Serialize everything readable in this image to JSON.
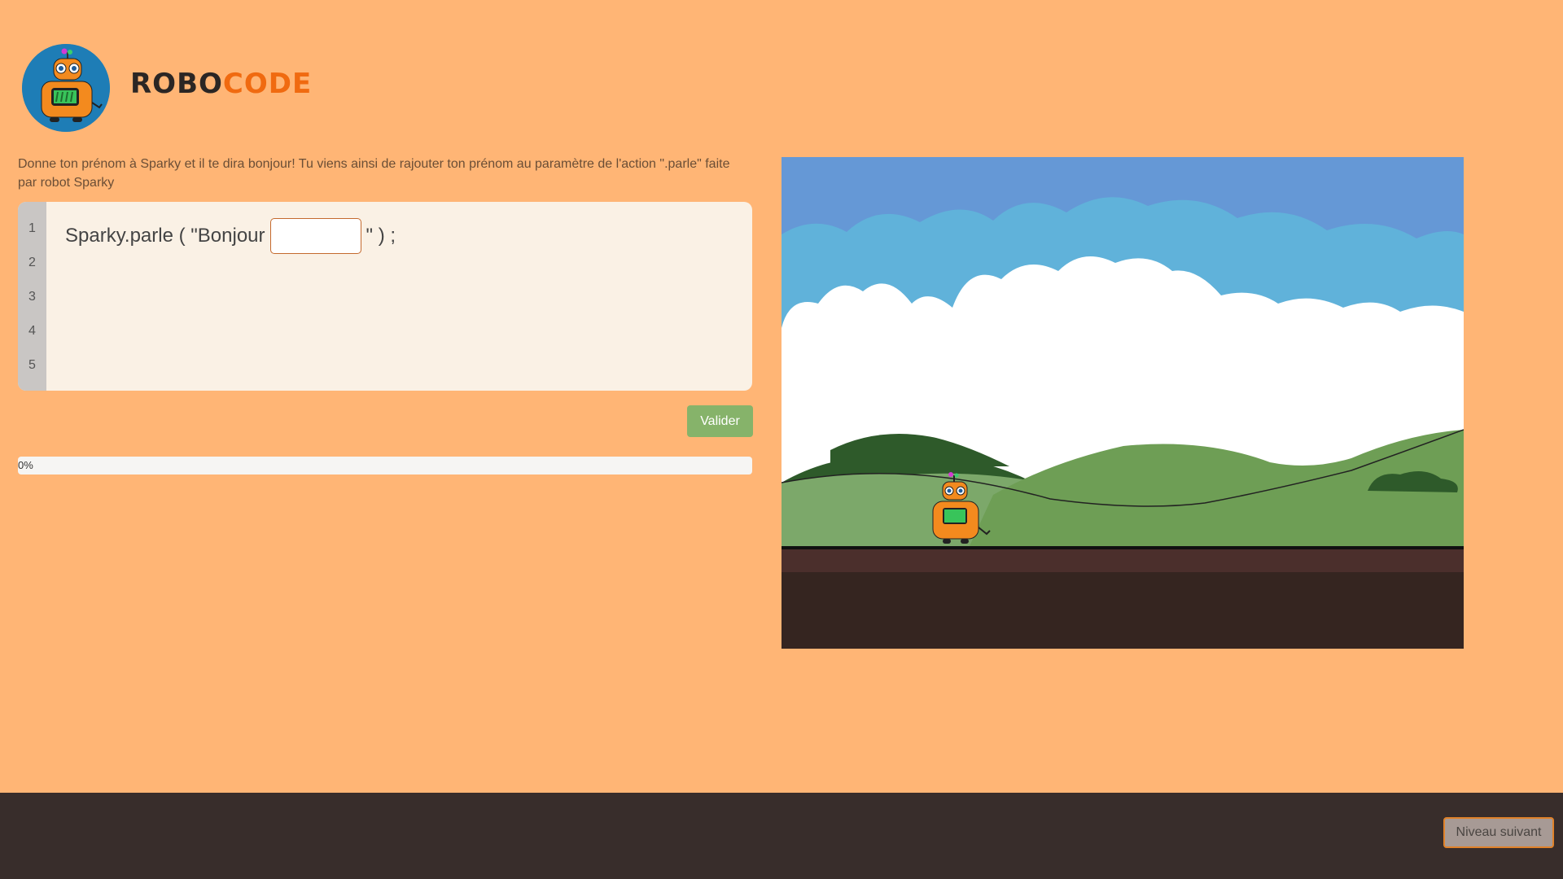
{
  "header": {
    "brand_part1": "ROBO",
    "brand_part2": "CODE",
    "logo_icon": "robot-mascot-icon"
  },
  "instructions": "Donne ton prénom à Sparky et il te dira bonjour! Tu viens ainsi de rajouter ton prénom au paramètre de l'action \".parle\" faite par robot Sparky",
  "editor": {
    "line_numbers": [
      "1",
      "2",
      "3",
      "4",
      "5"
    ],
    "code_prefix": "Sparky.parle ( \"Bonjour",
    "code_suffix": "\" ) ;",
    "input_value": ""
  },
  "actions": {
    "validate_label": "Valider"
  },
  "progress": {
    "value_percent": 0,
    "label": "0%"
  },
  "footer": {
    "next_level_label": "Niveau suivant"
  },
  "colors": {
    "page_background": "#FFB575",
    "accent_orange": "#F06A10",
    "validate_green": "#86B36A",
    "footer_dark": "#382D2B",
    "sky": "#6598D6"
  }
}
